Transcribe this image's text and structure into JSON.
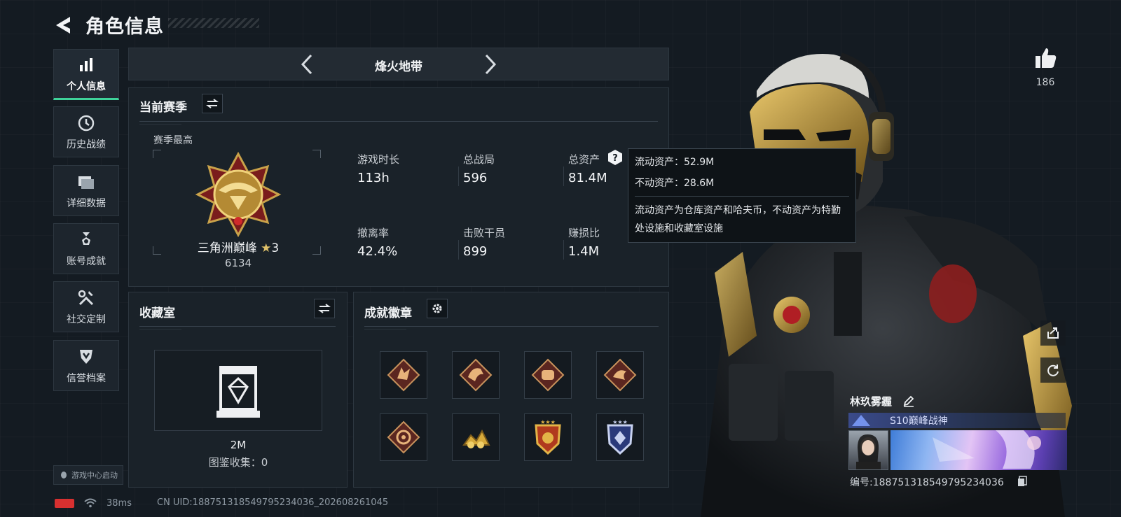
{
  "header": {
    "title": "角色信息"
  },
  "nav": {
    "items": [
      {
        "label": "个人信息",
        "icon": "bar-chart-icon",
        "active": true
      },
      {
        "label": "历史战绩",
        "icon": "clock-icon",
        "active": false
      },
      {
        "label": "详细数据",
        "icon": "folder-icon",
        "active": false
      },
      {
        "label": "账号成就",
        "icon": "medal-icon",
        "active": false
      },
      {
        "label": "社交定制",
        "icon": "tools-icon",
        "active": false
      },
      {
        "label": "信誉档案",
        "icon": "shield-icon",
        "active": false
      }
    ],
    "launcher_label": "游戏中心启动"
  },
  "mode_bar": {
    "name": "烽火地带"
  },
  "season": {
    "title": "当前赛季",
    "highest_label": "赛季最高",
    "rank_name": "三角洲巅峰",
    "rank_stars": "3",
    "rank_score": "6134",
    "stats": [
      {
        "label": "游戏时长",
        "value": "113h"
      },
      {
        "label": "总战局",
        "value": "596"
      },
      {
        "label": "总资产",
        "value": "81.4M"
      },
      {
        "label": "撤离率",
        "value": "42.4%"
      },
      {
        "label": "击败干员",
        "value": "899"
      },
      {
        "label": "赚损比",
        "value": "1.4M"
      }
    ]
  },
  "tooltip": {
    "liquid": "流动资产：52.9M",
    "fixed": "不动资产：28.6M",
    "description": "流动资产为仓库资产和哈夫币，不动资产为特勤处设施和收藏室设施"
  },
  "collection": {
    "title": "收藏室",
    "value": "2M",
    "count_label": "图鉴收集：0"
  },
  "badges": {
    "title": "成就徽章",
    "items": [
      "wolf-badge-icon",
      "dragon-badge-icon",
      "fist-badge-icon",
      "serpent-badge-icon",
      "wheel-badge-icon",
      "gold-pile-badge-icon",
      "gold-shield-badge-icon",
      "blue-shield-badge-icon"
    ]
  },
  "status": {
    "ping": "38ms",
    "uid": "CN UID:188751318549795234036_202608261045",
    "battery_color": "#d83030"
  },
  "profile": {
    "likes": "186",
    "name": "林玖雾霾",
    "title": "S10巅峰战神",
    "id": "编号:188751318549795234036"
  },
  "colors": {
    "accent": "#3fd39a",
    "panel": "#1a2229",
    "gold": "#c9a24a"
  }
}
